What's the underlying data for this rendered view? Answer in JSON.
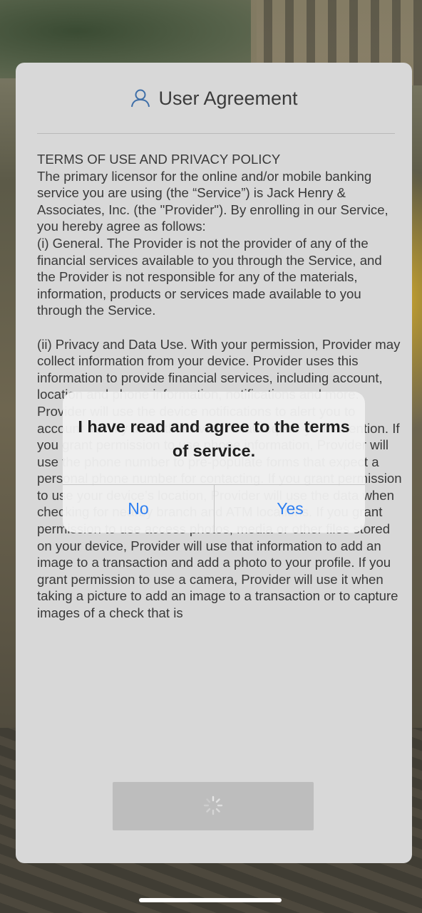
{
  "card": {
    "title": "User Agreement",
    "title_icon": "user-icon",
    "terms_heading": "TERMS OF USE AND PRIVACY POLICY",
    "terms_paragraph_1": "The primary licensor for the online and/or mobile banking service you are using (the “Service”) is Jack Henry & Associates, Inc. (the \"Provider\"). By enrolling in our Service, you hereby agree as follows:\n(i) General. The Provider is not the provider of any of the financial services available to you through the Service, and the Provider is not responsible for any of the materials, information, products or services made available to you through the Service.",
    "terms_paragraph_2": "(ii) Privacy and Data Use. With your permission, Provider may collect information from your device. Provider uses this information to provide financial services, including account, location and phone information, notifications and more. Provider will use the device notifications to alert you to account activity and other events that require your attention. If you grant permission to use phone information, Provider will use the phone number to pre-populate forms that expect a personal phone number for contacting. If you grant permission to use your device’s location, Provider will use the data when checking for nearby branch and ATM locations. If you grant permission to use access photos, media or other files stored on your device, Provider will use that information to add an image to a transaction and add a photo to your profile. If you grant permission to use a camera, Provider will use it when taking a picture to add an image to a transaction or to capture images of a check that is",
    "accept_button_state": "loading-spinner"
  },
  "alert": {
    "message": "I have read and agree to the terms of service.",
    "no_label": "No",
    "yes_label": "Yes"
  },
  "colors": {
    "card_bg": "#d8d8d8",
    "alert_button_text": "#2f7ff0",
    "body_text": "#3a3a3a"
  }
}
